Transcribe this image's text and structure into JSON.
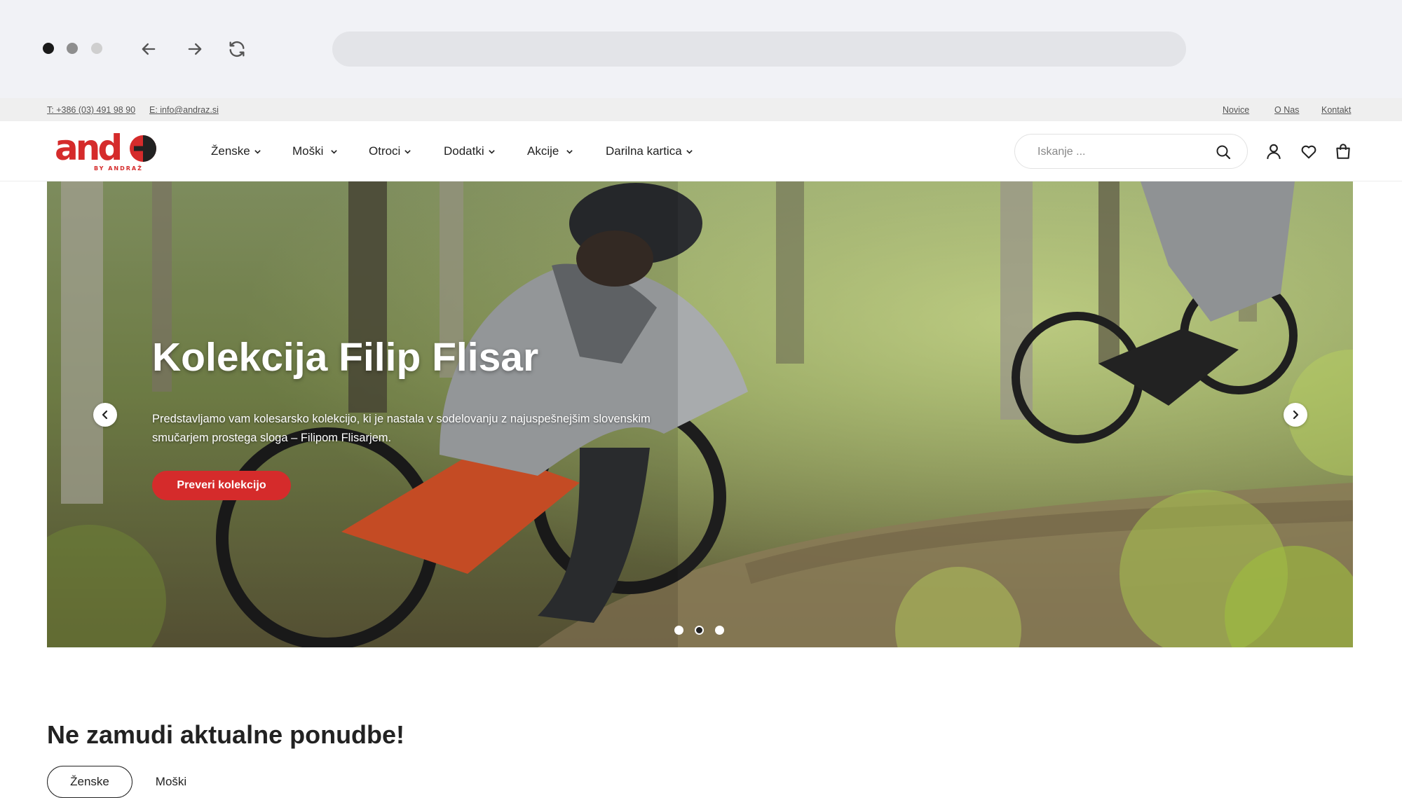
{
  "topbar": {
    "phone": "T: +386 (03) 491 98 90",
    "email": "E: info@andraz.si",
    "links": [
      "Novice",
      "O Nas",
      "Kontakt"
    ]
  },
  "header": {
    "logo_text": "and",
    "logo_subtext": "BY ANDRAŽ",
    "menu": [
      "Ženske",
      "Moški",
      "Otroci",
      "Dodatki",
      "Akcije",
      "Darilna kartica"
    ],
    "search_placeholder": "Iskanje ..."
  },
  "hero": {
    "title": "Kolekcija Filip Flisar",
    "description": "Predstavljamo vam kolesarsko kolekcijo, ki je nastala v sodelovanju z najuspešnejšim slovenskim smučarjem prostega sloga – Filipom Flisarjem.",
    "cta": "Preveri kolekcijo",
    "slides": 3,
    "active_slide": 2
  },
  "section": {
    "title": "Ne zamudi aktualne ponudbe!",
    "tabs": [
      "Ženske",
      "Moški"
    ],
    "active_tab": "Ženske"
  },
  "colors": {
    "brand_red": "#d52b2b",
    "topbar_bg": "#efefef",
    "chrome_bg": "#f1f2f6"
  }
}
